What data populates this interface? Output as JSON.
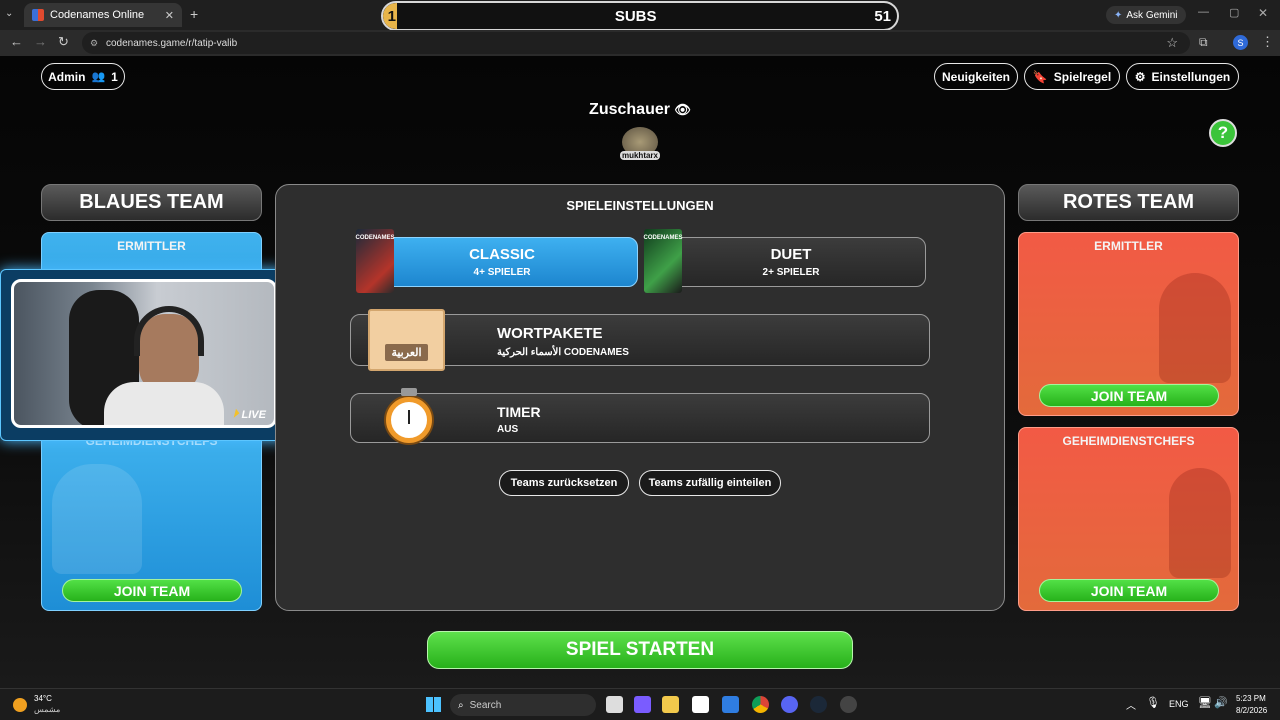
{
  "browser": {
    "tab_title": "Codenames Online",
    "url": "codenames.game/r/tatip-valib",
    "ask_gemini": "Ask Gemini",
    "profile_initial": "S"
  },
  "subs_bar": {
    "left_value": "1",
    "label": "SUBS",
    "right_value": "51",
    "progress": 0.02
  },
  "header": {
    "admin_label": "Admin",
    "admin_count": "1",
    "news_label": "Neuigkeiten",
    "rules_label": "Spielregel",
    "settings_label": "Einstellungen",
    "spectators_title": "Zuschauer",
    "spectator_name": "mukhtarx",
    "help_icon": "?"
  },
  "blue_team": {
    "title": "BLAUES TEAM",
    "operatives_label": "ERMITTLER",
    "spymasters_label": "GEHEIMDIENSTCHEFS",
    "join_label": "JOIN TEAM"
  },
  "red_team": {
    "title": "ROTES TEAM",
    "operatives_label": "ERMITTLER",
    "operatives_join": "JOIN TEAM",
    "spymasters_label": "GEHEIMDIENSTCHEFS",
    "spymasters_join": "JOIN TEAM"
  },
  "settings": {
    "title": "SPIELEINSTELLUNGEN",
    "classic_title": "CLASSIC",
    "classic_sub": "4+ SPIELER",
    "duet_title": "DUET",
    "duet_sub": "2+ SPIELER",
    "box_label": "CODENAMES",
    "wordpack_title": "WORTPAKETE",
    "wordpack_value": "الأسماء الحركية CODENAMES",
    "wordpack_card": "العربية",
    "timer_title": "TIMER",
    "timer_value": "AUS",
    "reset_label": "Teams zurücksetzen",
    "randomize_label": "Teams zufällig einteilen"
  },
  "start_label": "SPIEL STARTEN",
  "webcam": {
    "live_label": "LIVE"
  },
  "taskbar": {
    "temp": "34°C",
    "weather_text": "مشمس",
    "search_placeholder": "Search",
    "lang": "ENG",
    "time": "5:23 PM",
    "date": "8/2/2026"
  },
  "colors": {
    "blue": "#2a9be0",
    "red": "#ee5a41",
    "green": "#35c526",
    "panel": "#2e2e2e"
  }
}
